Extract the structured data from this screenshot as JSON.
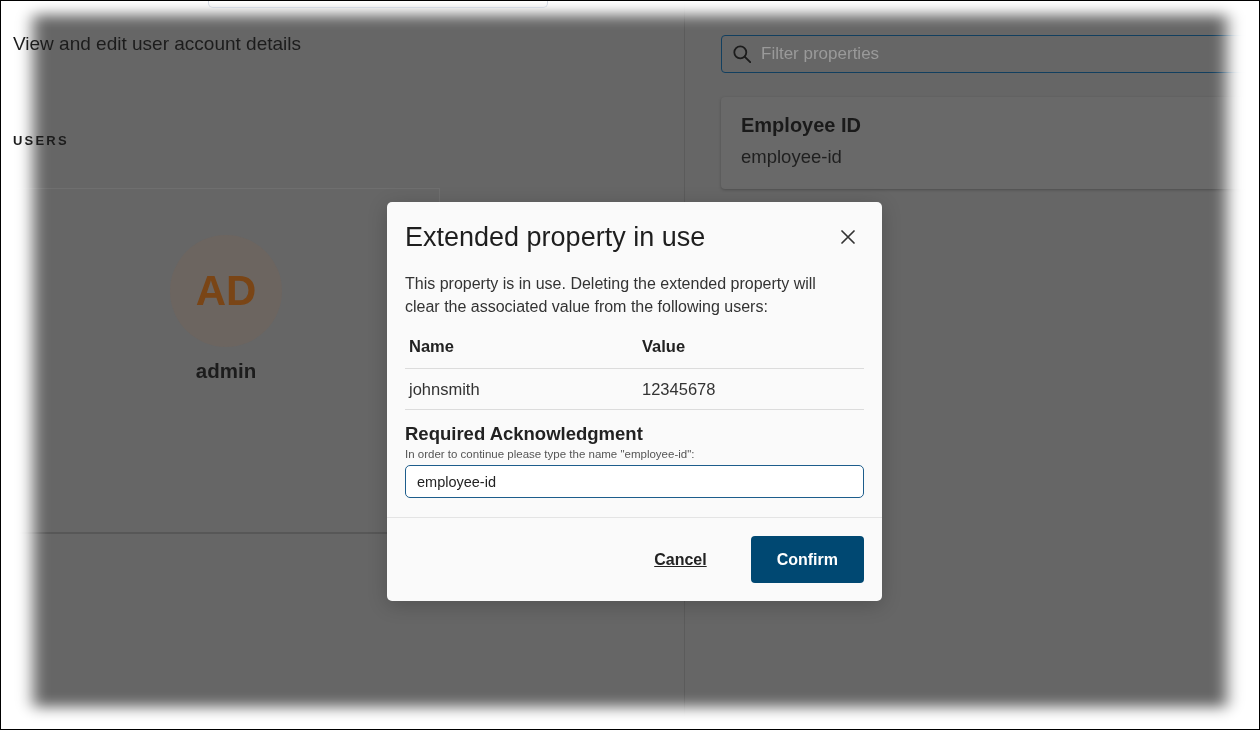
{
  "page": {
    "subtitle": "View and edit user account details",
    "section_label": "USERS"
  },
  "user_card": {
    "initials": "AD",
    "username": "admin"
  },
  "properties_panel": {
    "filter": {
      "placeholder": "Filter properties"
    },
    "properties": [
      {
        "title": "Employee ID",
        "key": "employee-id"
      }
    ]
  },
  "dialog": {
    "title": "Extended property in use",
    "message": "This property is in use. Deleting the extended property will clear the associated value from the following users:",
    "table": {
      "columns": [
        "Name",
        "Value"
      ],
      "rows": [
        [
          "johnsmith",
          "12345678"
        ]
      ]
    },
    "acknowledgment": {
      "heading": "Required Acknowledgment",
      "hint": "In order to continue please type the name \"employee-id\":",
      "value": "employee-id"
    },
    "buttons": [
      {
        "label": "Cancel",
        "kind": "link"
      },
      {
        "label": "Confirm",
        "kind": "primary"
      }
    ]
  }
}
